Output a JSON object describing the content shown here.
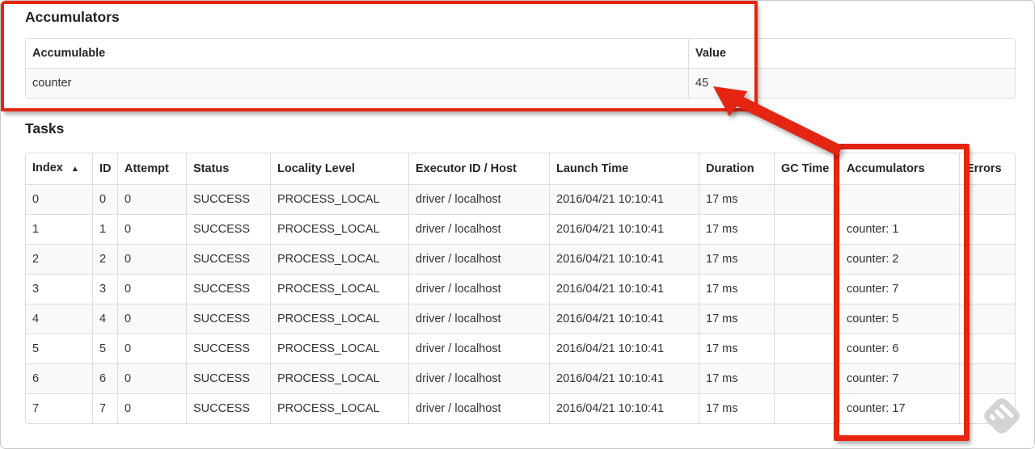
{
  "accumulators_section": {
    "heading": "Accumulators",
    "table": {
      "col_accumulable": "Accumulable",
      "col_value": "Value",
      "rows": [
        {
          "accumulable": "counter",
          "value": "45"
        }
      ]
    }
  },
  "tasks_section": {
    "heading": "Tasks",
    "table": {
      "headers": {
        "index": "Index",
        "sort_icon": "▲",
        "id": "ID",
        "attempt": "Attempt",
        "status": "Status",
        "locality": "Locality Level",
        "executor": "Executor ID / Host",
        "launch": "Launch Time",
        "duration": "Duration",
        "gc": "GC Time",
        "accumulators": "Accumulators",
        "errors": "Errors"
      },
      "rows": [
        {
          "index": "0",
          "id": "0",
          "attempt": "0",
          "status": "SUCCESS",
          "locality": "PROCESS_LOCAL",
          "executor": "driver / localhost",
          "launch": "2016/04/21 10:10:41",
          "duration": "17 ms",
          "gc": "",
          "accumulators": "",
          "errors": ""
        },
        {
          "index": "1",
          "id": "1",
          "attempt": "0",
          "status": "SUCCESS",
          "locality": "PROCESS_LOCAL",
          "executor": "driver / localhost",
          "launch": "2016/04/21 10:10:41",
          "duration": "17 ms",
          "gc": "",
          "accumulators": "counter: 1",
          "errors": ""
        },
        {
          "index": "2",
          "id": "2",
          "attempt": "0",
          "status": "SUCCESS",
          "locality": "PROCESS_LOCAL",
          "executor": "driver / localhost",
          "launch": "2016/04/21 10:10:41",
          "duration": "17 ms",
          "gc": "",
          "accumulators": "counter: 2",
          "errors": ""
        },
        {
          "index": "3",
          "id": "3",
          "attempt": "0",
          "status": "SUCCESS",
          "locality": "PROCESS_LOCAL",
          "executor": "driver / localhost",
          "launch": "2016/04/21 10:10:41",
          "duration": "17 ms",
          "gc": "",
          "accumulators": "counter: 7",
          "errors": ""
        },
        {
          "index": "4",
          "id": "4",
          "attempt": "0",
          "status": "SUCCESS",
          "locality": "PROCESS_LOCAL",
          "executor": "driver / localhost",
          "launch": "2016/04/21 10:10:41",
          "duration": "17 ms",
          "gc": "",
          "accumulators": "counter: 5",
          "errors": ""
        },
        {
          "index": "5",
          "id": "5",
          "attempt": "0",
          "status": "SUCCESS",
          "locality": "PROCESS_LOCAL",
          "executor": "driver / localhost",
          "launch": "2016/04/21 10:10:41",
          "duration": "17 ms",
          "gc": "",
          "accumulators": "counter: 6",
          "errors": ""
        },
        {
          "index": "6",
          "id": "6",
          "attempt": "0",
          "status": "SUCCESS",
          "locality": "PROCESS_LOCAL",
          "executor": "driver / localhost",
          "launch": "2016/04/21 10:10:41",
          "duration": "17 ms",
          "gc": "",
          "accumulators": "counter: 7",
          "errors": ""
        },
        {
          "index": "7",
          "id": "7",
          "attempt": "0",
          "status": "SUCCESS",
          "locality": "PROCESS_LOCAL",
          "executor": "driver / localhost",
          "launch": "2016/04/21 10:10:41",
          "duration": "17 ms",
          "gc": "",
          "accumulators": "counter: 17",
          "errors": ""
        }
      ]
    }
  },
  "annotations": {
    "color": "#e42511"
  }
}
